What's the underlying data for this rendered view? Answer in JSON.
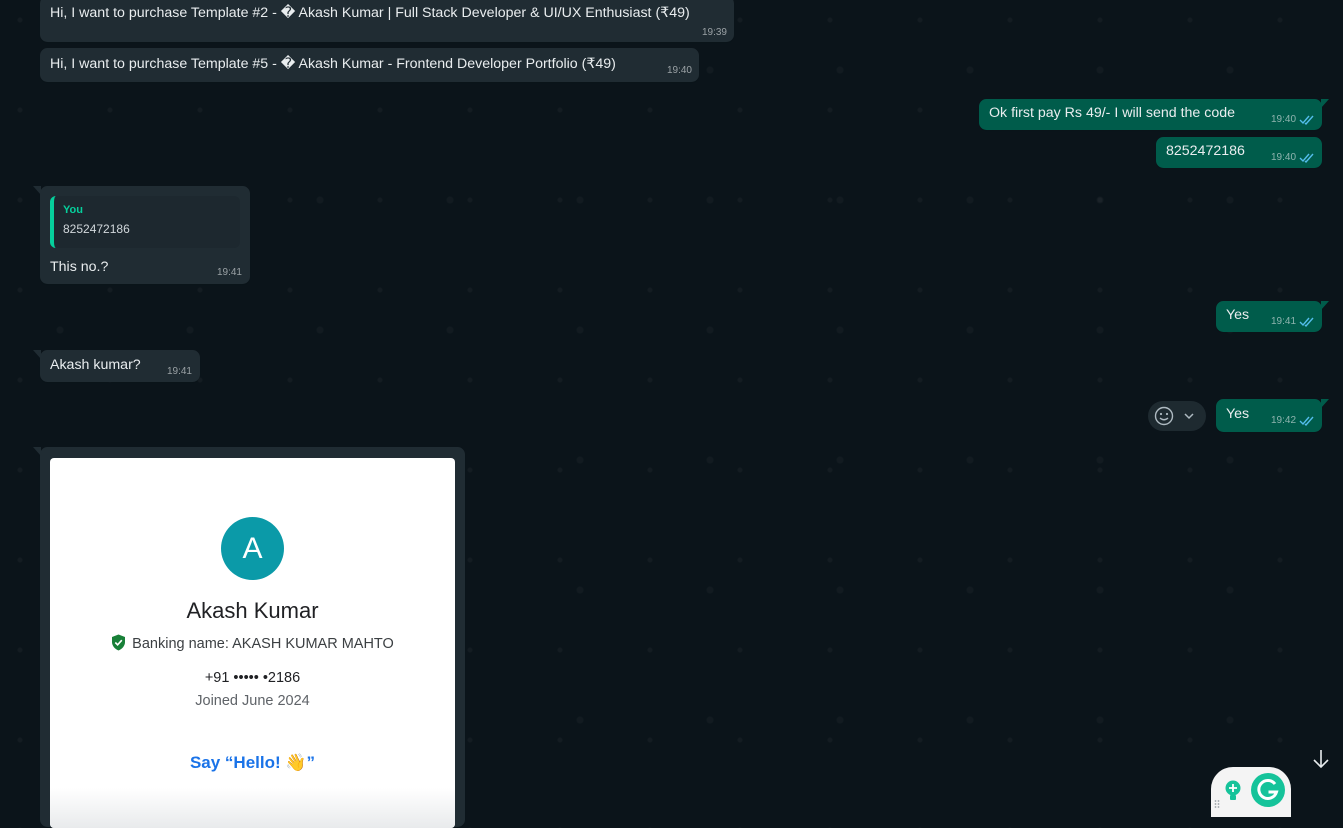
{
  "messages": [
    {
      "text": "Hi, I want to purchase Template #2 - � Akash Kumar | Full Stack Developer & UI/UX Enthusiast (₹49)",
      "time": "19:39"
    },
    {
      "text": "Hi, I want to purchase Template #5 - � Akash Kumar - Frontend Developer Portfolio (₹49)",
      "time": "19:40"
    },
    {
      "text": "Ok first pay Rs 49/- I will send the code",
      "time": "19:40"
    },
    {
      "text": "8252472186",
      "time": "19:40"
    },
    {
      "quote_author": "You",
      "quote_text": "8252472186",
      "text": "This no.?",
      "time": "19:41"
    },
    {
      "text": "Yes",
      "time": "19:41"
    },
    {
      "text": "Akash kumar?",
      "time": "19:41"
    },
    {
      "text": "Yes",
      "time": "19:42"
    }
  ],
  "image_card": {
    "avatar_letter": "A",
    "name": "Akash Kumar",
    "banking_name": "Banking name: AKASH KUMAR MAHTO",
    "phone": "+91 ••••• •2186",
    "joined": "Joined June 2024",
    "say_hello": "Say “Hello! 👋”"
  },
  "icons": {
    "read_ticks": "double-check-icon",
    "reaction": "emoji-smile-icon",
    "menu": "chevron-down-icon",
    "scroll": "arrow-down-icon",
    "grammarly": "grammarly-icon"
  },
  "colors": {
    "background": "#0b141a",
    "incoming": "#202c33",
    "outgoing": "#005c4b",
    "read_tick": "#53bdeb",
    "quote_accent": "#06cf9c",
    "avatar": "#0b9aa8",
    "hello_link": "#1a73e8"
  }
}
